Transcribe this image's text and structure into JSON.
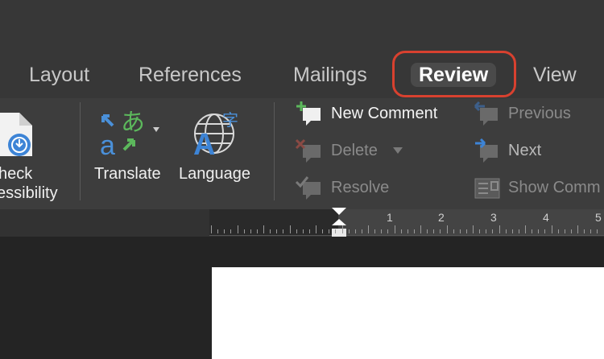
{
  "tabs": [
    {
      "label": "Layout"
    },
    {
      "label": "References"
    },
    {
      "label": "Mailings"
    },
    {
      "label": "Review",
      "active": true
    },
    {
      "label": "View"
    }
  ],
  "ribbon": {
    "check_accessibility": {
      "label_line1": "heck",
      "label_line2": "essibility",
      "icon": "accessibility-check-icon"
    },
    "translate": {
      "label": "Translate",
      "icon": "translate-icon"
    },
    "language": {
      "label": "Language",
      "icon": "language-icon"
    },
    "comments": {
      "new_comment": {
        "label": "New Comment",
        "icon": "new-comment-icon",
        "enabled": true
      },
      "delete": {
        "label": "Delete",
        "icon": "delete-comment-icon",
        "enabled": false
      },
      "resolve": {
        "label": "Resolve",
        "icon": "resolve-comment-icon",
        "enabled": false
      },
      "previous": {
        "label": "Previous",
        "icon": "previous-comment-icon",
        "enabled": false
      },
      "next": {
        "label": "Next",
        "icon": "next-comment-icon",
        "enabled": true
      },
      "show_comments": {
        "label": "Show Comm",
        "icon": "show-comments-icon",
        "enabled": false
      }
    }
  },
  "ruler": {
    "numbers": [
      "1",
      "2",
      "3",
      "4",
      "5"
    ]
  },
  "colors": {
    "highlight": "#d8412f",
    "active_tab_bg": "#4a4a4a",
    "accent_blue": "#4a90d9",
    "accent_green": "#5cb85c"
  }
}
